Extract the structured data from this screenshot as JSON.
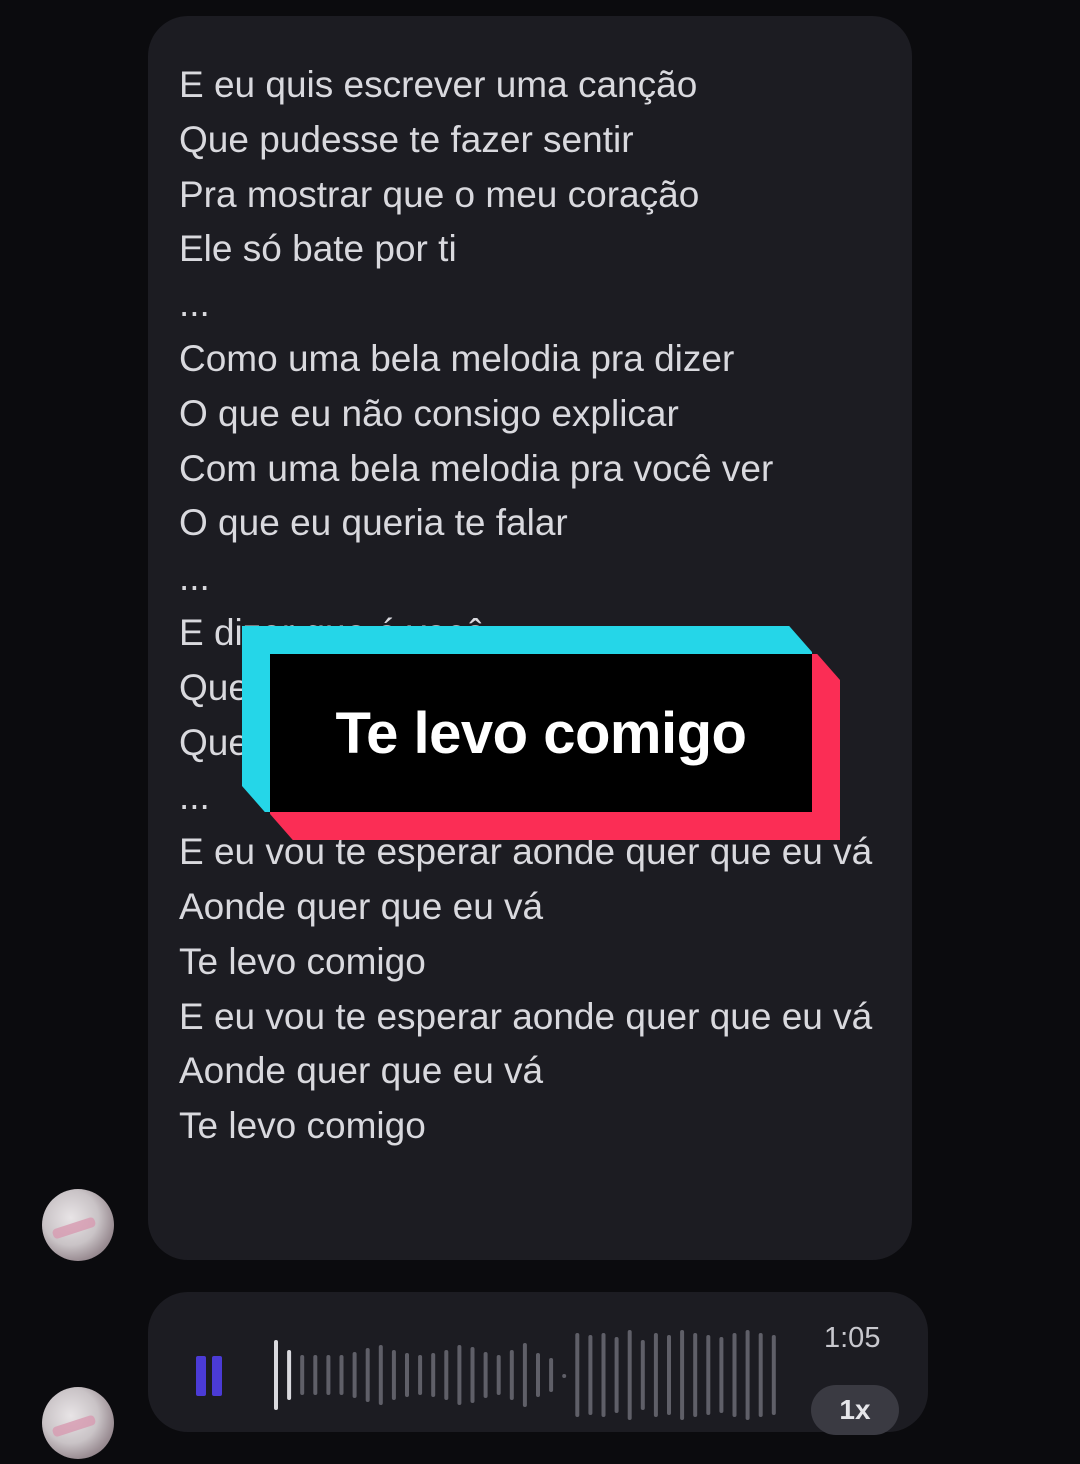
{
  "message": {
    "lyrics": [
      "E eu quis escrever uma canção",
      "Que pudesse te fazer sentir",
      "Pra mostrar que o meu coração",
      "Ele só bate por ti",
      "...",
      "Como uma bela melodia pra dizer",
      "O que eu não consigo explicar",
      "Com uma bela melodia pra você ver",
      "O que eu queria te falar",
      "...",
      "E dizer que é você",
      "Que",
      "Que",
      "...",
      "E eu vou te esperar aonde quer que eu vá",
      "Aonde quer que eu vá",
      "Te levo comigo",
      "E eu vou te esperar aonde quer que eu vá",
      "Aonde quer que eu vá",
      "Te levo comigo"
    ]
  },
  "audio_message": {
    "duration": "1:05",
    "speed": "1x",
    "state": "playing",
    "accent_color": "#4b3bd6"
  },
  "overlay_caption": {
    "text": "Te levo comigo",
    "colors": {
      "cyan": "#25d6e8",
      "red": "#fb2d55",
      "background": "#000000"
    }
  }
}
